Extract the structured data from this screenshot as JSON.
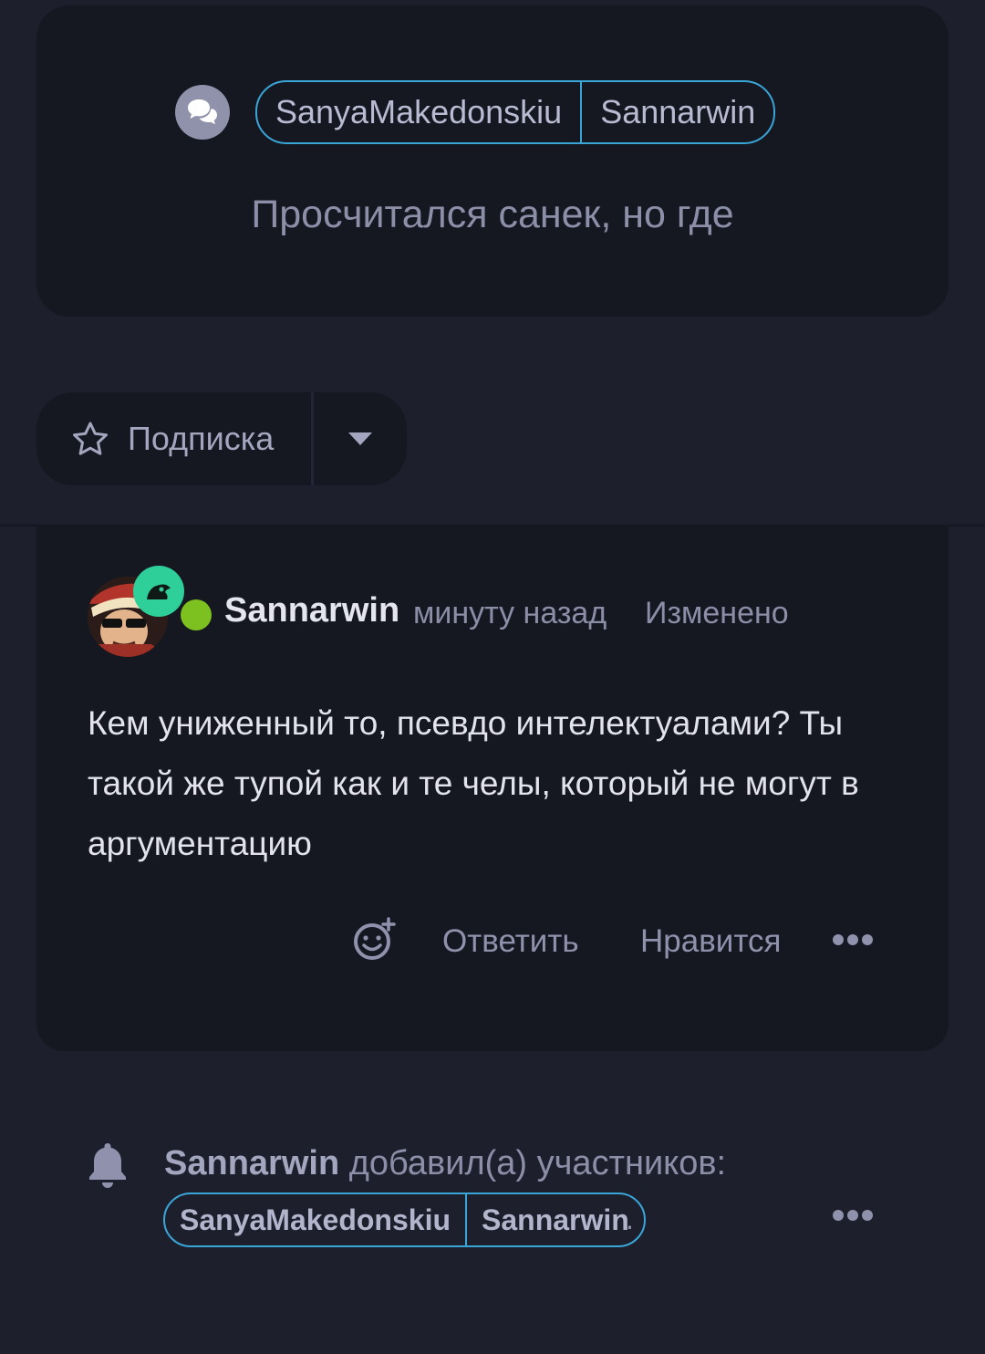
{
  "conversation": {
    "participants": [
      "SanyaMakedonskiu",
      "Sannarwin"
    ],
    "title": "Просчитался санек, но где"
  },
  "subscribe": {
    "label": "Подписка"
  },
  "post": {
    "author": "Sannarwin",
    "time": "минуту назад",
    "edited": "Изменено",
    "text": "Кем униженный то, псевдо интелектуалами? Ты такой же тупой как и те челы, который не могут в аргументацию",
    "reply_label": "Ответить",
    "like_label": "Нравится"
  },
  "notification": {
    "actor": "Sannarwin",
    "text": "добавил(а) участников:",
    "participants": [
      "SanyaMakedonskiu",
      "Sannarwin"
    ],
    "suffix": "."
  },
  "colors": {
    "background": "#1d1f2c",
    "card": "#151721",
    "accent_border": "#3aa6d8",
    "online": "#7cc11f",
    "badge": "#2fcf9a"
  },
  "icons": {
    "conversation": "chat-bubbles-icon",
    "subscribe": "star-icon",
    "dropdown": "caret-down-icon",
    "react": "emoji-add-icon",
    "more": "more-dots-icon",
    "notification": "bell-icon"
  }
}
